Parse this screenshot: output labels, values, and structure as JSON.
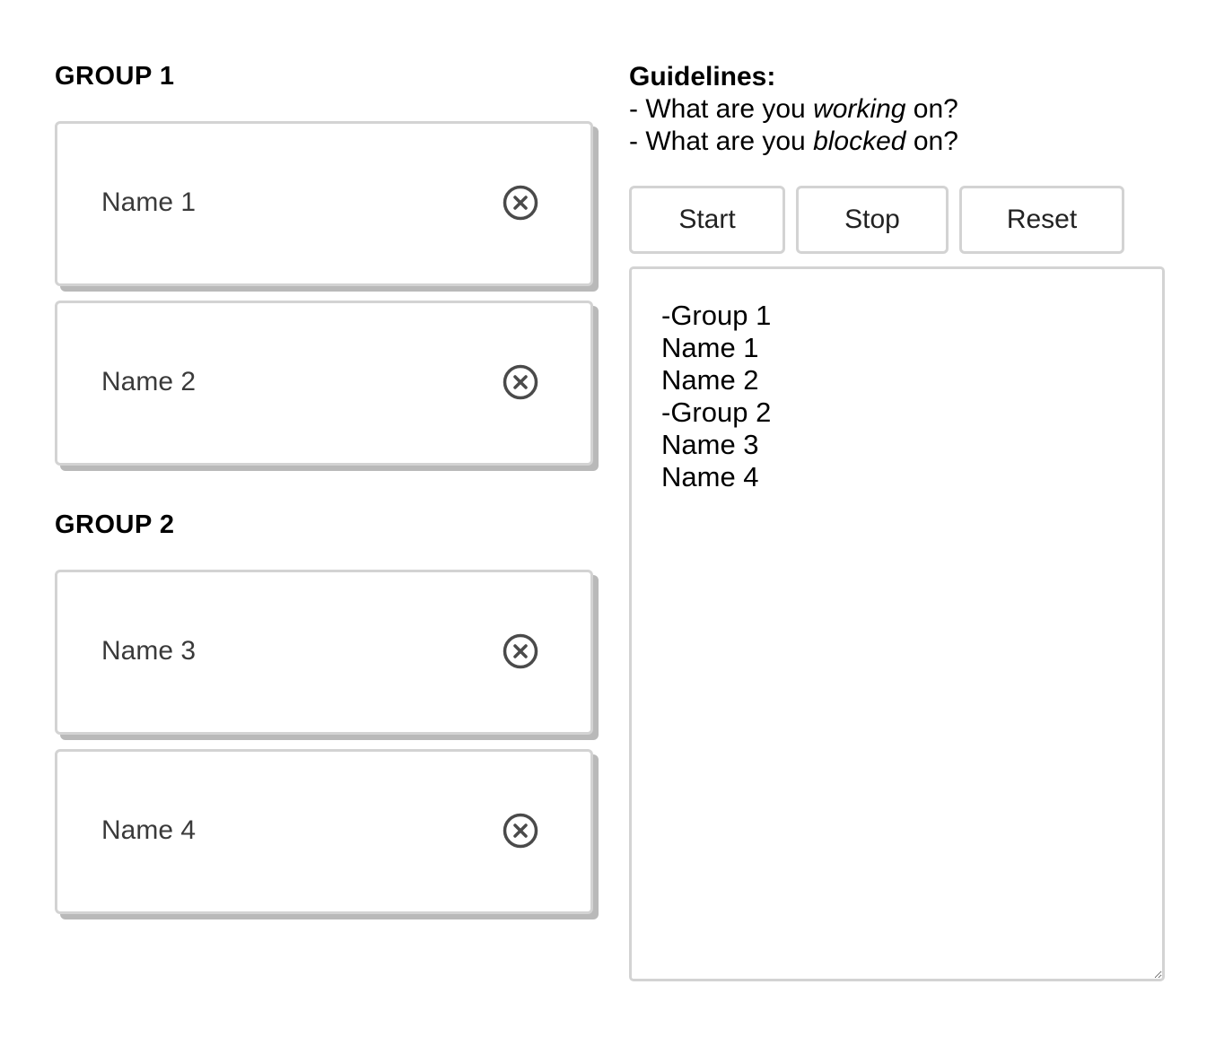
{
  "groups": [
    {
      "heading": "GROUP 1",
      "members": [
        {
          "name": "Name 1",
          "remove_icon": "circle-x-icon"
        },
        {
          "name": "Name 2",
          "remove_icon": "circle-x-icon"
        }
      ]
    },
    {
      "heading": "GROUP 2",
      "members": [
        {
          "name": "Name 3",
          "remove_icon": "circle-x-icon"
        },
        {
          "name": "Name 4",
          "remove_icon": "circle-x-icon"
        }
      ]
    }
  ],
  "guidelines": {
    "title": "Guidelines:",
    "line1_prefix": "- What are you ",
    "line1_emphasis": "working",
    "line1_suffix": " on?",
    "line2_prefix": "- What are you ",
    "line2_emphasis": "blocked",
    "line2_suffix": " on?"
  },
  "controls": {
    "start_label": "Start",
    "stop_label": "Stop",
    "reset_label": "Reset"
  },
  "output": {
    "value": "-Group 1\nName 1\nName 2\n-Group 2\nName 3\nName 4"
  },
  "colors": {
    "card_border": "#d3d3d3",
    "card_shadow": "#b9b9b9",
    "icon_stroke": "#4a4a4a"
  }
}
